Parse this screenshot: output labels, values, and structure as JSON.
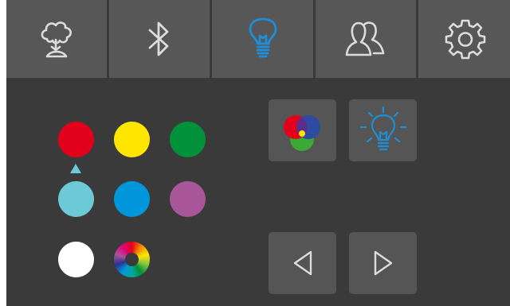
{
  "tabs": [
    {
      "icon": "cloud-tree-icon",
      "active": false
    },
    {
      "icon": "bluetooth-icon",
      "active": false
    },
    {
      "icon": "light-bulb-icon",
      "active": true
    },
    {
      "icon": "users-icon",
      "active": false
    },
    {
      "icon": "settings-gear-icon",
      "active": false
    }
  ],
  "colors": {
    "red": "#e2001a",
    "yellow": "#ffe600",
    "green": "#00913a",
    "cyan": "#6ccad6",
    "blue": "#0096dc",
    "purple": "#a8559a",
    "white": "#ffffff",
    "accent": "#1e8fd6",
    "tab_bg": "#575757",
    "panel_bg": "#3a3a3a"
  },
  "selected_color": "cyan",
  "tiles": [
    {
      "icon": "rgb-mix-icon"
    },
    {
      "icon": "light-bulb-glow-icon"
    },
    {
      "icon": "previous-arrow-icon"
    },
    {
      "icon": "next-arrow-icon"
    }
  ]
}
